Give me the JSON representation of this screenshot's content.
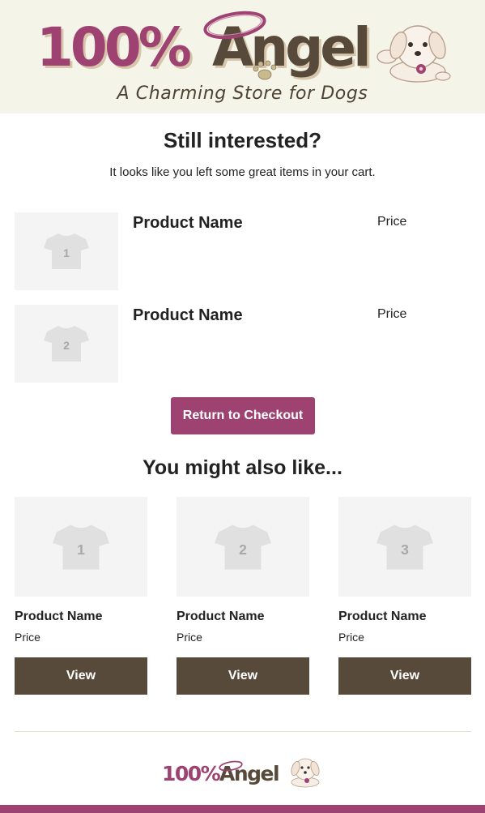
{
  "brand": {
    "logo_text_part1": "100%",
    "logo_text_part2": "Angel",
    "tagline": "A Charming Store for Dogs"
  },
  "intro": {
    "headline": "Still interested?",
    "subline": "It looks like you left some great items in your cart."
  },
  "cart": {
    "items": [
      {
        "number": "1",
        "name": "Product Name",
        "price": "Price"
      },
      {
        "number": "2",
        "name": "Product Name",
        "price": "Price"
      }
    ],
    "checkout_label": "Return to Checkout"
  },
  "recommendations": {
    "title": "You might also like...",
    "items": [
      {
        "number": "1",
        "name": "Product Name",
        "price": "Price",
        "button": "View"
      },
      {
        "number": "2",
        "name": "Product Name",
        "price": "Price",
        "button": "View"
      },
      {
        "number": "3",
        "name": "Product Name",
        "price": "Price",
        "button": "View"
      }
    ]
  },
  "colors": {
    "brand_magenta": "#9e4371",
    "brand_brown": "#574a3a",
    "header_bg": "#f5f4e8",
    "placeholder_bg": "#f4f4f4"
  },
  "icons": [
    "dog-mascot-icon",
    "halo-icon",
    "paw-print-icon",
    "t-shirt-icon"
  ]
}
